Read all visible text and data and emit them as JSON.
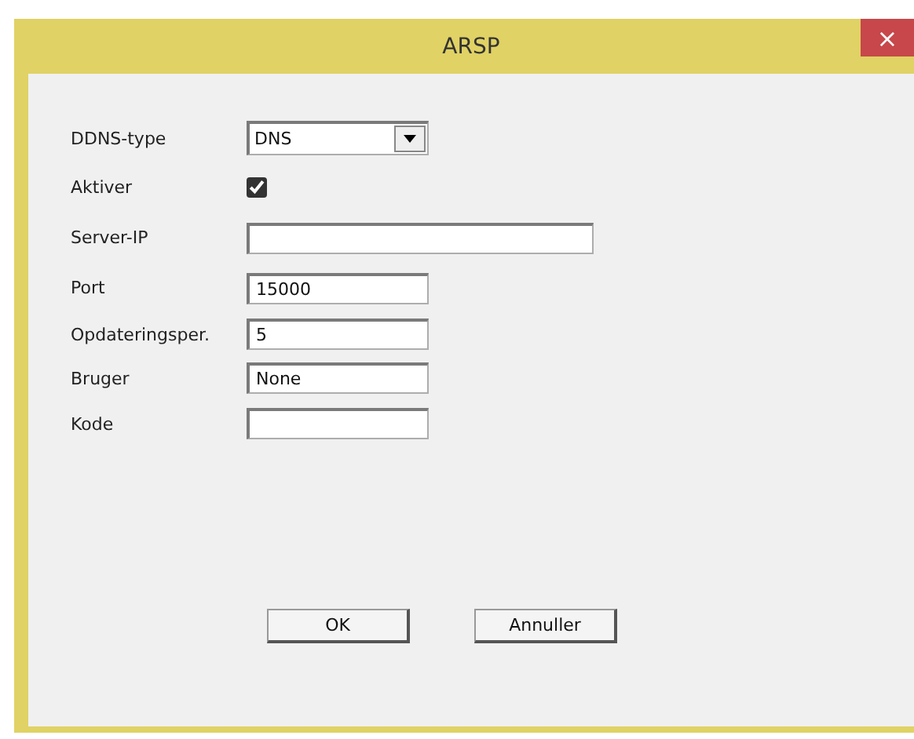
{
  "window": {
    "title": "ARSP",
    "close": "×"
  },
  "fields": [
    {
      "kind": "combo",
      "label": "DDNS-type",
      "value": "DNS"
    },
    {
      "kind": "checkbox",
      "label": "Aktiver",
      "checked": true
    },
    {
      "kind": "wide",
      "label": "Server-IP"
    },
    {
      "kind": "text",
      "label": "Port",
      "value": "15000"
    },
    {
      "kind": "text",
      "label": "Opdateringsper.",
      "value": "5"
    },
    {
      "kind": "text",
      "label": "Bruger",
      "value": "None"
    },
    {
      "kind": "text",
      "label": "Kode"
    }
  ],
  "buttons": [
    "OK",
    "Annuller"
  ]
}
